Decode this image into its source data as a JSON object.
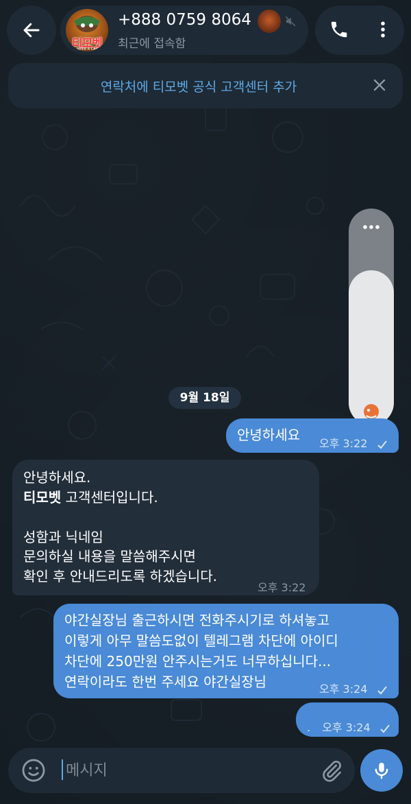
{
  "header": {
    "contact_name": "+888 0759 8064",
    "status": "최근에 접속함",
    "avatar_text": "티모벳",
    "avatar_subtext": "INTER A CAS"
  },
  "banner": {
    "text": "연락처에 티모벳 공식 고객센터 추가"
  },
  "date_chip": "9월 18일",
  "messages": [
    {
      "lines": [
        "안녕하세요"
      ],
      "time": "오후 3:22",
      "direction": "out"
    },
    {
      "lines": [
        "안녕하세요.",
        "티모벳",
        " 고객센터입니다.",
        "",
        "성함과 닉네임",
        "문의하실 내용을 말씀해주시면",
        "확인 후 안내드리도록 하겠습니다."
      ],
      "time": "오후 3:22",
      "direction": "in"
    },
    {
      "lines": [
        "야간실장님 출근하시면 전화주시기로 하셔놓고",
        "이렇게 아무 말씀도없이 텔레그램 차단에 아이디",
        "차단에 250만원 안주시는거도 너무하십니다...",
        "연락이라도 한번 주세요 야간실장님"
      ],
      "time": "오후 3:24",
      "direction": "out"
    },
    {
      "lines": [
        "."
      ],
      "time": "오후 3:24",
      "direction": "out"
    }
  ],
  "composer": {
    "placeholder": "메시지"
  },
  "colors": {
    "accent": "#4a8ad6",
    "link": "#5ea9e8",
    "background": "#141c24",
    "panel": "#1e2a35"
  },
  "icons": [
    "back-arrow-icon",
    "mute-icon",
    "phone-icon",
    "more-vertical-icon",
    "close-icon",
    "emoji-icon",
    "paperclip-icon",
    "microphone-icon",
    "double-check-icon"
  ]
}
